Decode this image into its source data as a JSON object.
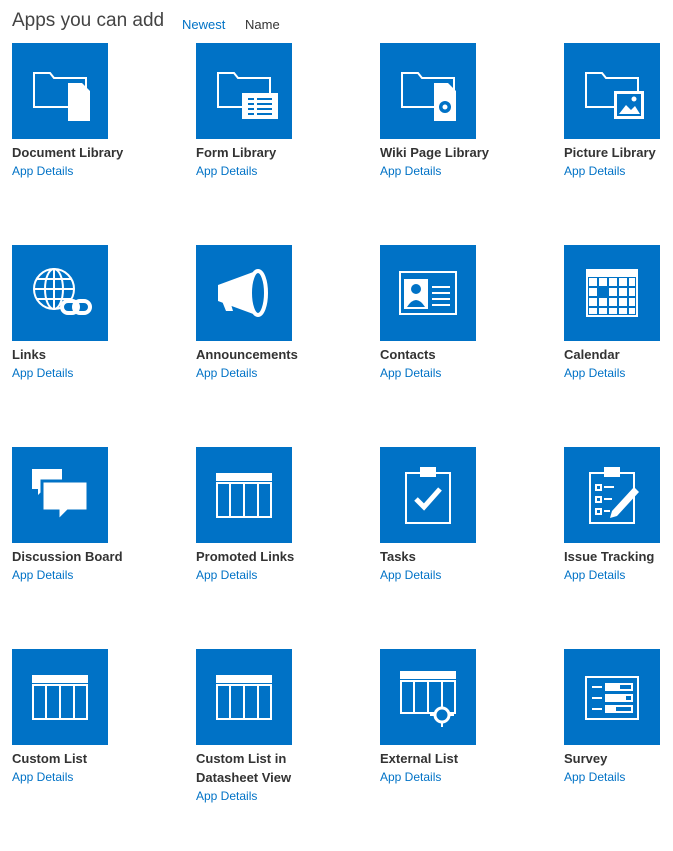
{
  "header": {
    "title": "Apps you can add",
    "sort_newest": "Newest",
    "sort_name": "Name"
  },
  "colors": {
    "tile": "#0072c6",
    "link": "#0072c6"
  },
  "apps": [
    {
      "name": "Document Library",
      "details": "App Details",
      "icon": "document-library-icon"
    },
    {
      "name": "Form Library",
      "details": "App Details",
      "icon": "form-library-icon"
    },
    {
      "name": "Wiki Page Library",
      "details": "App Details",
      "icon": "wiki-page-library-icon"
    },
    {
      "name": "Picture Library",
      "details": "App Details",
      "icon": "picture-library-icon"
    },
    {
      "name": "Links",
      "details": "App Details",
      "icon": "links-icon"
    },
    {
      "name": "Announcements",
      "details": "App Details",
      "icon": "megaphone-icon"
    },
    {
      "name": "Contacts",
      "details": "App Details",
      "icon": "contact-card-icon"
    },
    {
      "name": "Calendar",
      "details": "App Details",
      "icon": "calendar-icon"
    },
    {
      "name": "Discussion Board",
      "details": "App Details",
      "icon": "speech-bubbles-icon"
    },
    {
      "name": "Promoted Links",
      "details": "App Details",
      "icon": "promoted-links-icon"
    },
    {
      "name": "Tasks",
      "details": "App Details",
      "icon": "clipboard-check-icon"
    },
    {
      "name": "Issue Tracking",
      "details": "App Details",
      "icon": "clipboard-pencil-icon"
    },
    {
      "name": "Custom List",
      "details": "App Details",
      "icon": "custom-list-icon"
    },
    {
      "name": "Custom List in Datasheet View",
      "details": "App Details",
      "icon": "datasheet-list-icon"
    },
    {
      "name": "External List",
      "details": "App Details",
      "icon": "external-list-icon"
    },
    {
      "name": "Survey",
      "details": "App Details",
      "icon": "survey-icon"
    }
  ]
}
